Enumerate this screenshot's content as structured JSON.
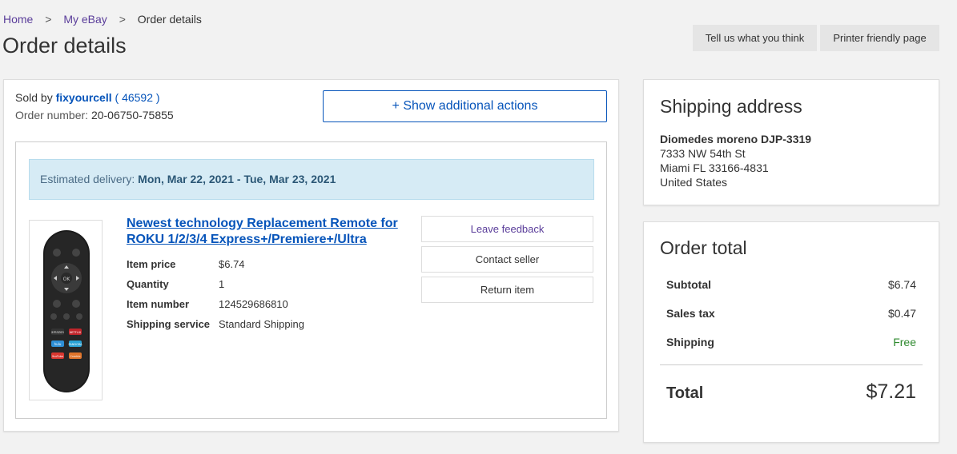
{
  "breadcrumb": {
    "home": "Home",
    "sep": ">",
    "my_ebay": "My eBay",
    "current": "Order details"
  },
  "page_title": "Order details",
  "top_buttons": {
    "feedback": "Tell us what you think",
    "printer": "Printer friendly page"
  },
  "order": {
    "sold_by_label": "Sold by",
    "seller": "fixyourcell",
    "feedback_open": "(",
    "feedback_score": "46592",
    "feedback_close": ")",
    "order_number_label": "Order number:",
    "order_number": "20-06750-75855",
    "show_actions": "+ Show additional actions",
    "delivery_label": "Estimated delivery:",
    "delivery_dates": "Mon, Mar 22, 2021 - Tue, Mar 23, 2021",
    "item": {
      "title": "Newest technology Replacement Remote for ROKU 1/2/3/4 Express+/Premiere+/Ultra",
      "price_label": "Item price",
      "price": "$6.74",
      "quantity_label": "Quantity",
      "quantity": "1",
      "item_number_label": "Item number",
      "item_number": "124529686810",
      "shipping_label": "Shipping service",
      "shipping": "Standard Shipping",
      "thumbnail_icon": "remote-control-image",
      "remote_labels": {
        "ok": "OK",
        "amazon": "amazon",
        "netflix": "NETFLIX",
        "hulu": "hulu",
        "pandora": "PANDORA",
        "youtube": "YouTube",
        "crackle": "Crackle"
      }
    },
    "actions": {
      "leave_feedback": "Leave feedback",
      "contact_seller": "Contact seller",
      "return_item": "Return item"
    }
  },
  "shipping_address": {
    "title": "Shipping address",
    "name": "Diomedes moreno DJP-3319",
    "line1": "7333 NW 54th St",
    "line2": "Miami FL 33166-4831",
    "country": "United States"
  },
  "order_total": {
    "title": "Order total",
    "subtotal_label": "Subtotal",
    "subtotal": "$6.74",
    "tax_label": "Sales tax",
    "tax": "$0.47",
    "shipping_label": "Shipping",
    "shipping": "Free",
    "total_label": "Total",
    "total": "$7.21"
  },
  "colors": {
    "link": "#0654ba",
    "visited": "#5a3d9a",
    "delivery_bg": "#d6ebf5",
    "free": "#2f8a2f"
  }
}
